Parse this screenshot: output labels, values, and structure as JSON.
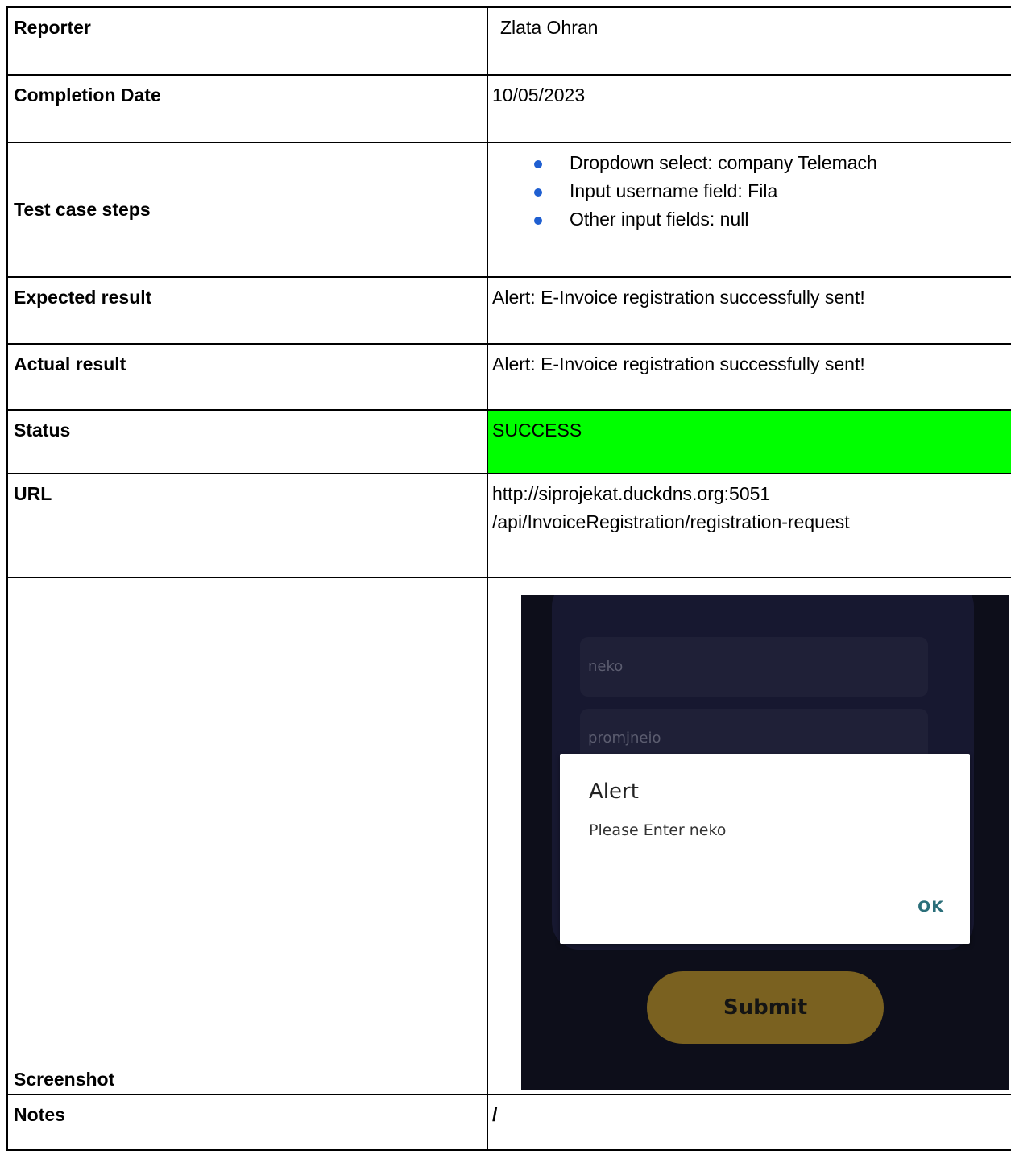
{
  "rows": {
    "reporter": {
      "label": "Reporter",
      "value": "Zlata Ohran"
    },
    "completion_date": {
      "label": "Completion Date",
      "value": "10/05/2023"
    },
    "test_case_steps": {
      "label": "Test case steps",
      "steps": [
        "Dropdown select: company Telemach",
        "Input username field: Fila",
        "Other input fields: null"
      ]
    },
    "expected_result": {
      "label": "Expected result",
      "value": "Alert: E-Invoice registration successfully sent!"
    },
    "actual_result": {
      "label": "Actual result",
      "value": "Alert: E-Invoice registration successfully sent!"
    },
    "status": {
      "label": "Status",
      "value": "SUCCESS",
      "color": "#00ff00"
    },
    "url": {
      "label": "URL",
      "lines": [
        "http://siprojekat.duckdns.org:5051",
        "/api/InvoiceRegistration/registration-request"
      ]
    },
    "screenshot": {
      "label": "Screenshot",
      "app": {
        "field_1_placeholder": "neko",
        "field_2_placeholder": "promjneio",
        "alert_title": "Alert",
        "alert_message": "Please Enter neko",
        "alert_ok": "OK",
        "submit_label": "Submit"
      }
    },
    "notes": {
      "label": "Notes",
      "value": "/"
    }
  },
  "colors": {
    "bullet": "#1f5fd1",
    "status_bg": "#00ff00",
    "app_bg": "#0d0e1a",
    "submit_bg": "#7a6120",
    "alert_ok": "#2b6f7a"
  }
}
